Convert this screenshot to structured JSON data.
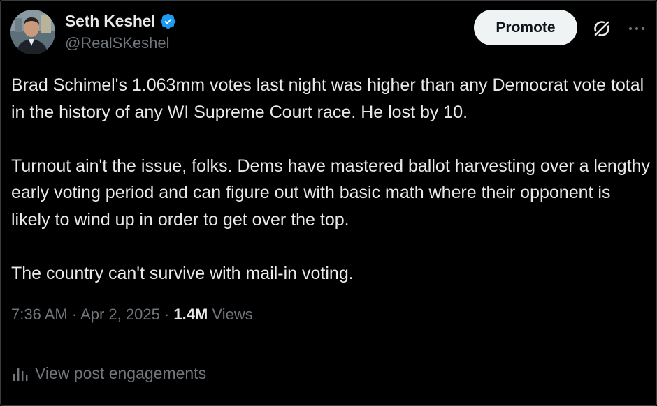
{
  "author": {
    "display_name": "Seth Keshel",
    "handle": "@RealSKeshel",
    "verified": true
  },
  "actions": {
    "promote_label": "Promote",
    "grok_icon": "grok-slash-circle-icon",
    "more_icon": "more-horizontal-icon"
  },
  "tweet": {
    "paragraphs": [
      "Brad Schimel's 1.063mm votes last night was higher than any Democrat vote total in the history of any WI Supreme Court race. He lost by 10.",
      "Turnout ain't the issue, folks. Dems have mastered ballot harvesting over a lengthy early voting period and can figure out with basic math where their opponent is likely to wind up in order to get over the top.",
      "The country can't survive with mail-in voting."
    ]
  },
  "meta": {
    "time": "7:36 AM",
    "separator": " · ",
    "date": "Apr 2, 2025",
    "views_count": "1.4M",
    "views_label": "Views"
  },
  "engagements": {
    "label": "View post engagements",
    "icon": "bar-chart-icon"
  },
  "colors": {
    "background": "#000000",
    "primary_text": "#e7e9ea",
    "secondary_text": "#71767b",
    "verified_blue": "#1d9bf0",
    "promote_bg": "#eff3f4"
  }
}
